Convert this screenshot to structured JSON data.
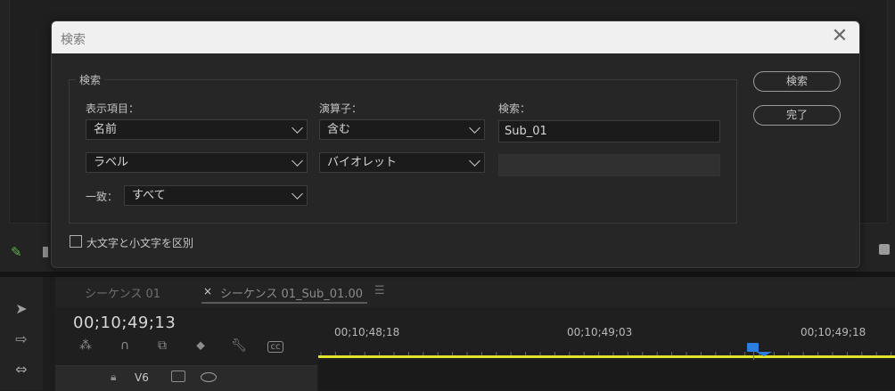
{
  "dialog": {
    "title": "検索",
    "close_glyph": "✕",
    "group_label": "検索",
    "column_label": "表示項目：",
    "operator_label": "演算子：",
    "search_label": "検索：",
    "column1_value": "名前",
    "operator1_value": "含む",
    "search1_value": "Sub_01",
    "column2_value": "ラベル",
    "operator2_value": "バイオレット",
    "search2_value": "",
    "match_label": "一致：",
    "match_value": "すべて",
    "case_label": "大文字と小文字を区別",
    "case_checked": false,
    "find_button": "検索",
    "done_button": "完了"
  },
  "timeline": {
    "tabs": [
      {
        "label": "シーケンス 01",
        "active": false
      },
      {
        "label": "シーケンス 01_Sub_01.00",
        "active": true
      }
    ],
    "close_tab_glyph": "×",
    "menu_glyph": "☰",
    "timecode": "00;10;49;13",
    "ruler_labels": [
      "00;10;48;18",
      "00;10;49;03",
      "00;10;49;18"
    ],
    "track": {
      "name": "V6"
    }
  },
  "colors": {
    "accent": "#2b7de0",
    "work_area": "#e3e32a"
  }
}
